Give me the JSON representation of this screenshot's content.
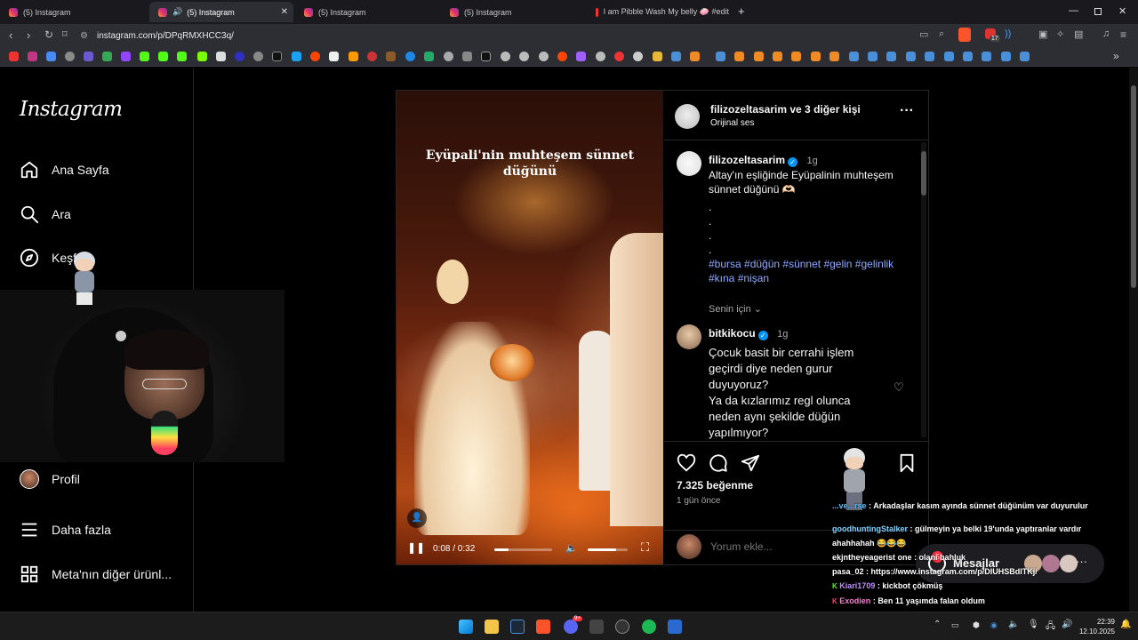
{
  "browser": {
    "tabs": [
      {
        "title": "(5) Instagram",
        "icon": "instagram-icon",
        "active": false
      },
      {
        "title": "(5) Instagram",
        "icon": "instagram-icon",
        "active": true,
        "audio": true
      },
      {
        "title": "(5) Instagram",
        "icon": "instagram-icon",
        "active": false
      },
      {
        "title": "(5) Instagram",
        "icon": "instagram-icon",
        "active": false
      },
      {
        "title": "I am Pibble Wash My belly 🧼 #edit",
        "icon": "youtube-icon",
        "active": false
      }
    ],
    "new_tab_symbol": "+",
    "url": "instagram.com/p/DPqRMXHCC3q/",
    "extension_badge": "17"
  },
  "sidebar": {
    "logo": "Instagram",
    "items": [
      {
        "label": "Ana Sayfa",
        "icon": "home-icon"
      },
      {
        "label": "Ara",
        "icon": "search-icon"
      },
      {
        "label": "Keşfet",
        "icon": "compass-icon"
      },
      {
        "label": "Profil",
        "icon": "avatar"
      },
      {
        "label": "Daha fazla",
        "icon": "menu-icon"
      },
      {
        "label": "Meta'nın diğer ürünl...",
        "icon": "grid-icon"
      }
    ]
  },
  "post": {
    "video": {
      "overlay_title": "Eyüpali'nin muhteşem sünnet düğünü",
      "time": "0:08 / 0:32",
      "progress": 0.25,
      "volume": 0.7
    },
    "header": {
      "username": "filizozeltasarim",
      "with_others": "ve 3 diğer kişi",
      "audio": "Orijinal ses"
    },
    "caption": {
      "username": "filizozeltasarim",
      "age": "1g",
      "text": "Altay'ın eşliğinde Eyüpalinin muhteşem sünnet düğünü 🫶🏻",
      "dots": [
        ".",
        ".",
        ".",
        "."
      ],
      "hashtags": "#bursa #düğün #sünnet #gelin #gelinlik #kına #nişan",
      "for_you": "Senin için"
    },
    "comments": [
      {
        "username": "bitkikocu",
        "age": "1g",
        "lines": [
          "Çocuk basit bir cerrahi işlem",
          "geçirdi diye neden gurur",
          "duyuyoruz?",
          "Ya da kızlarımız regl olunca",
          "neden aynı şekilde düğün",
          "yapılmıyor?"
        ]
      }
    ],
    "likes": "7.325 beğenme",
    "posted": "1 gün önce",
    "comment_placeholder": "Yorum ekle..."
  },
  "messages": {
    "label": "Mesajlar",
    "badge": "5"
  },
  "chat": [
    {
      "user": "...ve...rse",
      "text": ": Arkadaşlar kasım ayında sünnet düğünüm var duyurulur",
      "color": "#5fbfff"
    },
    {
      "user": "goodhuntingStalker",
      "text": ": gülmeyin ya belki 19'unda yaptıranlar vardır ahahhahah 😂😂😂",
      "color": "#7fd0ff"
    },
    {
      "user": "ekjntheyeagerist one",
      "text": ": olanı bahluk",
      "color": "#e0e0e0"
    },
    {
      "user": "pasa_02",
      "text": ": https://www.instagram.com/p/DIUHSBdITKj/",
      "color": "#e0e0e0"
    },
    {
      "user": "Kiari1709",
      "text": ": kickbot çökmüş",
      "color": "#c08cff"
    },
    {
      "user": "Exodien",
      "text": ": Ben 11 yaşımda falan oldum",
      "color": "#ff7ad0"
    }
  ],
  "taskbar": {
    "time": "22:39",
    "date": "12.10.2025",
    "discord_badge": "9+"
  },
  "colors": {
    "link": "#8fa8ff",
    "verified": "#0095f6",
    "accent": "#e1306c"
  }
}
